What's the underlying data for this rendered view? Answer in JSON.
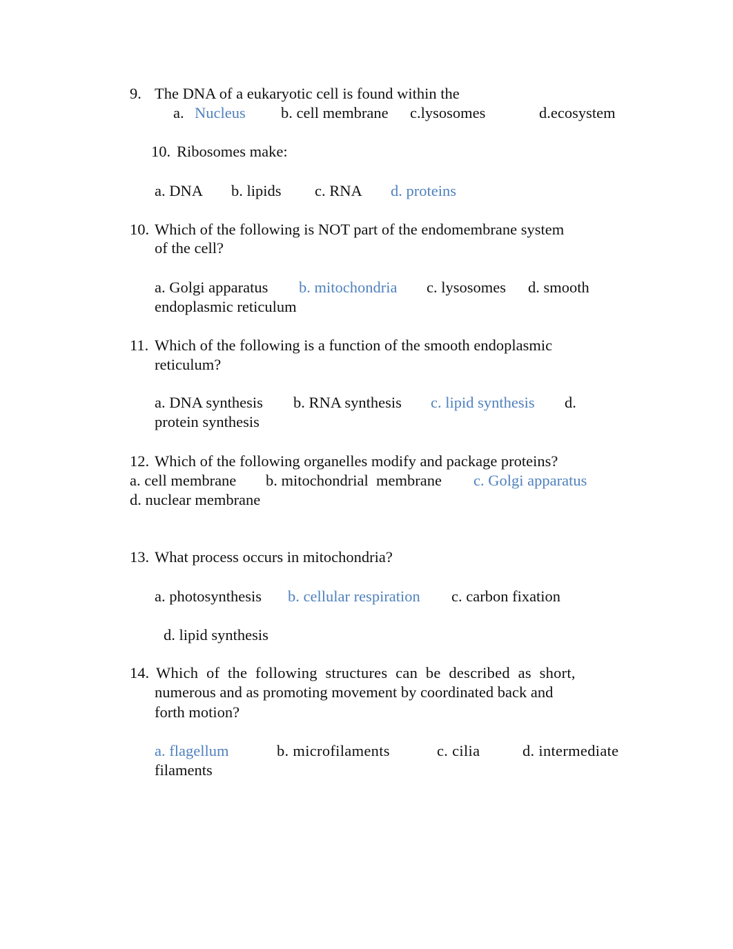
{
  "answer_color": "#4f81bd",
  "questions": [
    {
      "number": "9.",
      "text": "The DNA of a eukaryotic cell is found within the",
      "options": [
        "a.",
        "Nucleus",
        "b. cell membrane",
        "c.lysosomes",
        "d.ecosystem"
      ],
      "correct": "a"
    },
    {
      "number": "10.",
      "text": "Ribosomes make:",
      "options": [
        "a. DNA",
        "b. lipids",
        "c. RNA",
        "d. proteins"
      ],
      "correct": "d"
    },
    {
      "number": "10.",
      "text_line1": "Which of the following is NOT part of the endomembrane system",
      "text_line2": "of the cell?",
      "options": [
        "a. Golgi apparatus",
        "b. mitochondria",
        "c. lysosomes",
        "d. smooth",
        "endoplasmic reticulum"
      ],
      "correct": "b"
    },
    {
      "number": "11.",
      "text_line1": "Which of the following is a function of the smooth endoplasmic",
      "text_line2": "reticulum?",
      "options": [
        "a. DNA synthesis",
        "b. RNA synthesis",
        "c. lipid synthesis",
        "d.",
        "protein synthesis"
      ],
      "correct": "c"
    },
    {
      "number": "12.",
      "text": "Which of the following organelles modify and package proteins?",
      "options": [
        "a. cell membrane",
        "b. mitochondrial  membrane",
        "c. Golgi apparatus",
        "d. nuclear membrane"
      ],
      "correct": "c"
    },
    {
      "number": "13.",
      "text": "What process occurs in mitochondria?",
      "options": [
        "a. photosynthesis",
        "b. cellular respiration",
        "c. carbon fixation",
        "d. lipid synthesis"
      ],
      "correct": "b"
    },
    {
      "number": "14.",
      "text_line1": "Which  of  the  following  structures  can  be  described  as  short,",
      "text_line2": "numerous and as promoting movement by coordinated back and",
      "text_line3": "forth motion?",
      "options": [
        "a. flagellum",
        "b. microfilaments",
        "c. cilia",
        "d. intermediate",
        "filaments"
      ],
      "correct": "a"
    }
  ]
}
